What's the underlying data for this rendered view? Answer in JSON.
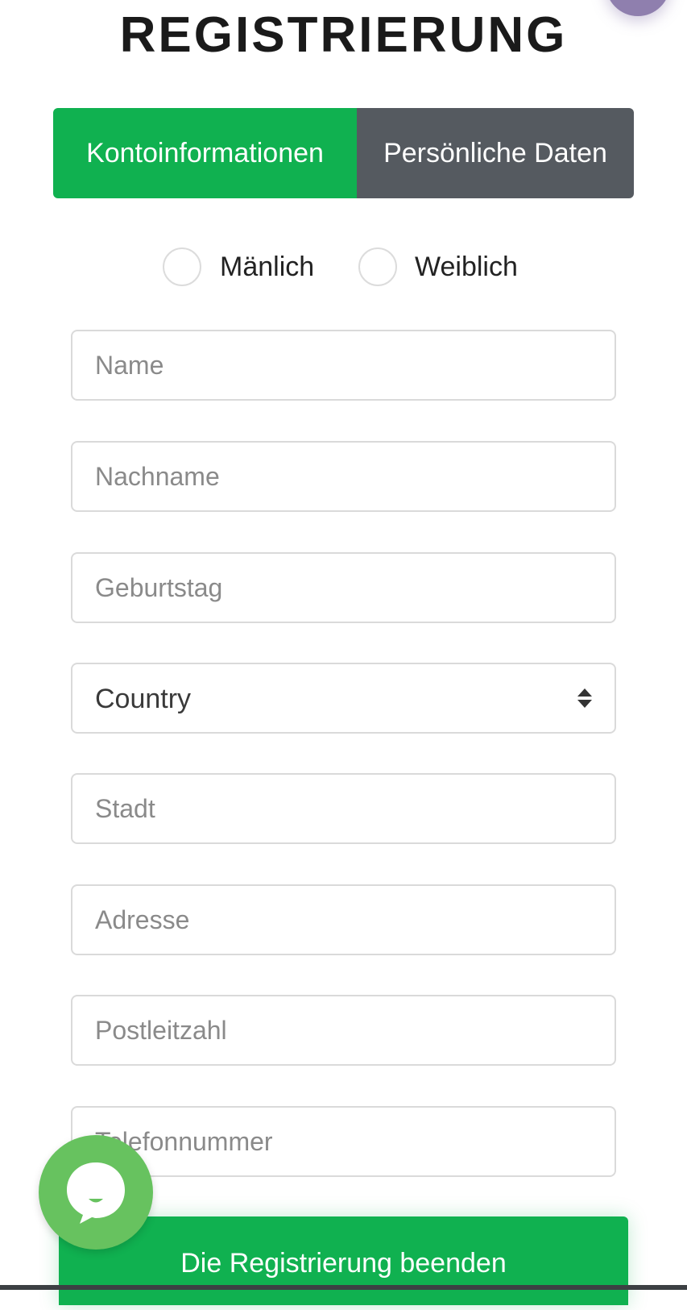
{
  "page": {
    "title": "REGISTRIERUNG"
  },
  "tabs": [
    {
      "label": "Kontoinformationen",
      "active": true
    },
    {
      "label": "Persönliche Daten",
      "active": false
    }
  ],
  "gender": {
    "options": [
      {
        "label": "Mänlich",
        "checked": false
      },
      {
        "label": "Weiblich",
        "checked": false
      }
    ]
  },
  "form": {
    "name": {
      "placeholder": "Name",
      "value": ""
    },
    "surname": {
      "placeholder": "Nachname",
      "value": ""
    },
    "birthday": {
      "placeholder": "Geburtstag",
      "value": ""
    },
    "country": {
      "selected": "Country"
    },
    "city": {
      "placeholder": "Stadt",
      "value": ""
    },
    "address": {
      "placeholder": "Adresse",
      "value": ""
    },
    "postcode": {
      "placeholder": "Postleitzahl",
      "value": ""
    },
    "phone": {
      "placeholder": "Telefonnummer",
      "value": ""
    }
  },
  "submit": {
    "label": "Die Registrierung beenden"
  },
  "chat": {
    "icon": "chat-bubble-icon"
  },
  "colors": {
    "primary_green": "#10b150",
    "tab_inactive": "#555a60",
    "chat_green": "#67c25f",
    "corner_purple": "#8f7fae"
  }
}
